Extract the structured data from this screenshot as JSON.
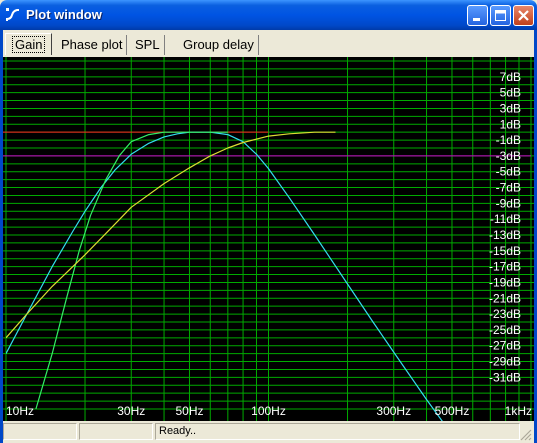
{
  "window": {
    "title": "Plot window"
  },
  "icons": {
    "app": "plot-app-icon",
    "minimize": "minimize-icon",
    "maximize": "maximize-icon",
    "close": "close-icon"
  },
  "tabs": [
    {
      "label": "Gain",
      "active": true
    },
    {
      "label": "Phase plot",
      "active": false
    },
    {
      "label": "SPL",
      "active": false
    },
    {
      "label": "Group delay",
      "active": false
    }
  ],
  "status": {
    "panel1": "",
    "panel2": "",
    "message": "Ready.."
  },
  "colors": {
    "grid": "#00aa00",
    "background": "#000000",
    "label": "#ffffff",
    "ref_line": "#ff2020",
    "ref_line_low": "#cc00cc",
    "lowpass": "#33ddee",
    "highpass_steep": "#33ee66",
    "highpass_gentle": "#dddd33"
  },
  "chart_data": {
    "type": "line",
    "x_scale": "log",
    "xlim": [
      10,
      1000
    ],
    "ylim": [
      -35,
      9
    ],
    "x_ticks": [
      {
        "value": 10,
        "label": "10Hz"
      },
      {
        "value": 30,
        "label": "30Hz"
      },
      {
        "value": 50,
        "label": "50Hz"
      },
      {
        "value": 100,
        "label": "100Hz"
      },
      {
        "value": 300,
        "label": "300Hz"
      },
      {
        "value": 500,
        "label": "500Hz"
      },
      {
        "value": 1000,
        "label": "1kHz"
      }
    ],
    "y_ticks": [
      {
        "value": 7,
        "label": "7dB"
      },
      {
        "value": 5,
        "label": "5dB"
      },
      {
        "value": 3,
        "label": "3dB"
      },
      {
        "value": 1,
        "label": "1dB"
      },
      {
        "value": -1,
        "label": "-1dB"
      },
      {
        "value": -3,
        "label": "-3dB"
      },
      {
        "value": -5,
        "label": "-5dB"
      },
      {
        "value": -7,
        "label": "-7dB"
      },
      {
        "value": -9,
        "label": "-9dB"
      },
      {
        "value": -11,
        "label": "-11dB"
      },
      {
        "value": -13,
        "label": "-13dB"
      },
      {
        "value": -15,
        "label": "-15dB"
      },
      {
        "value": -17,
        "label": "-17dB"
      },
      {
        "value": -19,
        "label": "-19dB"
      },
      {
        "value": -21,
        "label": "-21dB"
      },
      {
        "value": -23,
        "label": "-23dB"
      },
      {
        "value": -25,
        "label": "-25dB"
      },
      {
        "value": -27,
        "label": "-27dB"
      },
      {
        "value": -29,
        "label": "-29dB"
      },
      {
        "value": -31,
        "label": "-31dB"
      }
    ],
    "reference_lines": [
      {
        "value": 0,
        "x_range": [
          10,
          100
        ],
        "color": "#ff2020"
      },
      {
        "value": -3,
        "x_range": [
          10,
          1000
        ],
        "color": "#cc00cc"
      }
    ],
    "grid": true,
    "series": [
      {
        "color": "#33ddee",
        "x": [
          10,
          12,
          15,
          18,
          20,
          23,
          26,
          30,
          35,
          40,
          45,
          50,
          55,
          60,
          70,
          80,
          90,
          100,
          120,
          150,
          200,
          250,
          300,
          400,
          470
        ],
        "y": [
          -28,
          -23,
          -17,
          -12.5,
          -10,
          -7,
          -4.8,
          -2.8,
          -1.4,
          -0.6,
          -0.2,
          0,
          0,
          0,
          -0.3,
          -1.2,
          -2.8,
          -4.6,
          -8.3,
          -13,
          -19.2,
          -24,
          -27.8,
          -33.8,
          -37
        ]
      },
      {
        "color": "#33ee66",
        "x": [
          13,
          15,
          17,
          19,
          21,
          24,
          27,
          30,
          35,
          40,
          50,
          60,
          70
        ],
        "y": [
          -35,
          -28,
          -21,
          -15,
          -10.5,
          -6,
          -3,
          -1.2,
          -0.3,
          0,
          0,
          0,
          0
        ]
      },
      {
        "color": "#dddd33",
        "x": [
          10,
          12,
          15,
          20,
          25,
          30,
          40,
          50,
          60,
          70,
          80,
          100,
          120,
          150,
          180
        ],
        "y": [
          -26,
          -23,
          -19.5,
          -15.5,
          -12.2,
          -9.5,
          -6.5,
          -4.5,
          -3,
          -2,
          -1.3,
          -0.5,
          -0.2,
          0,
          0
        ]
      }
    ]
  }
}
